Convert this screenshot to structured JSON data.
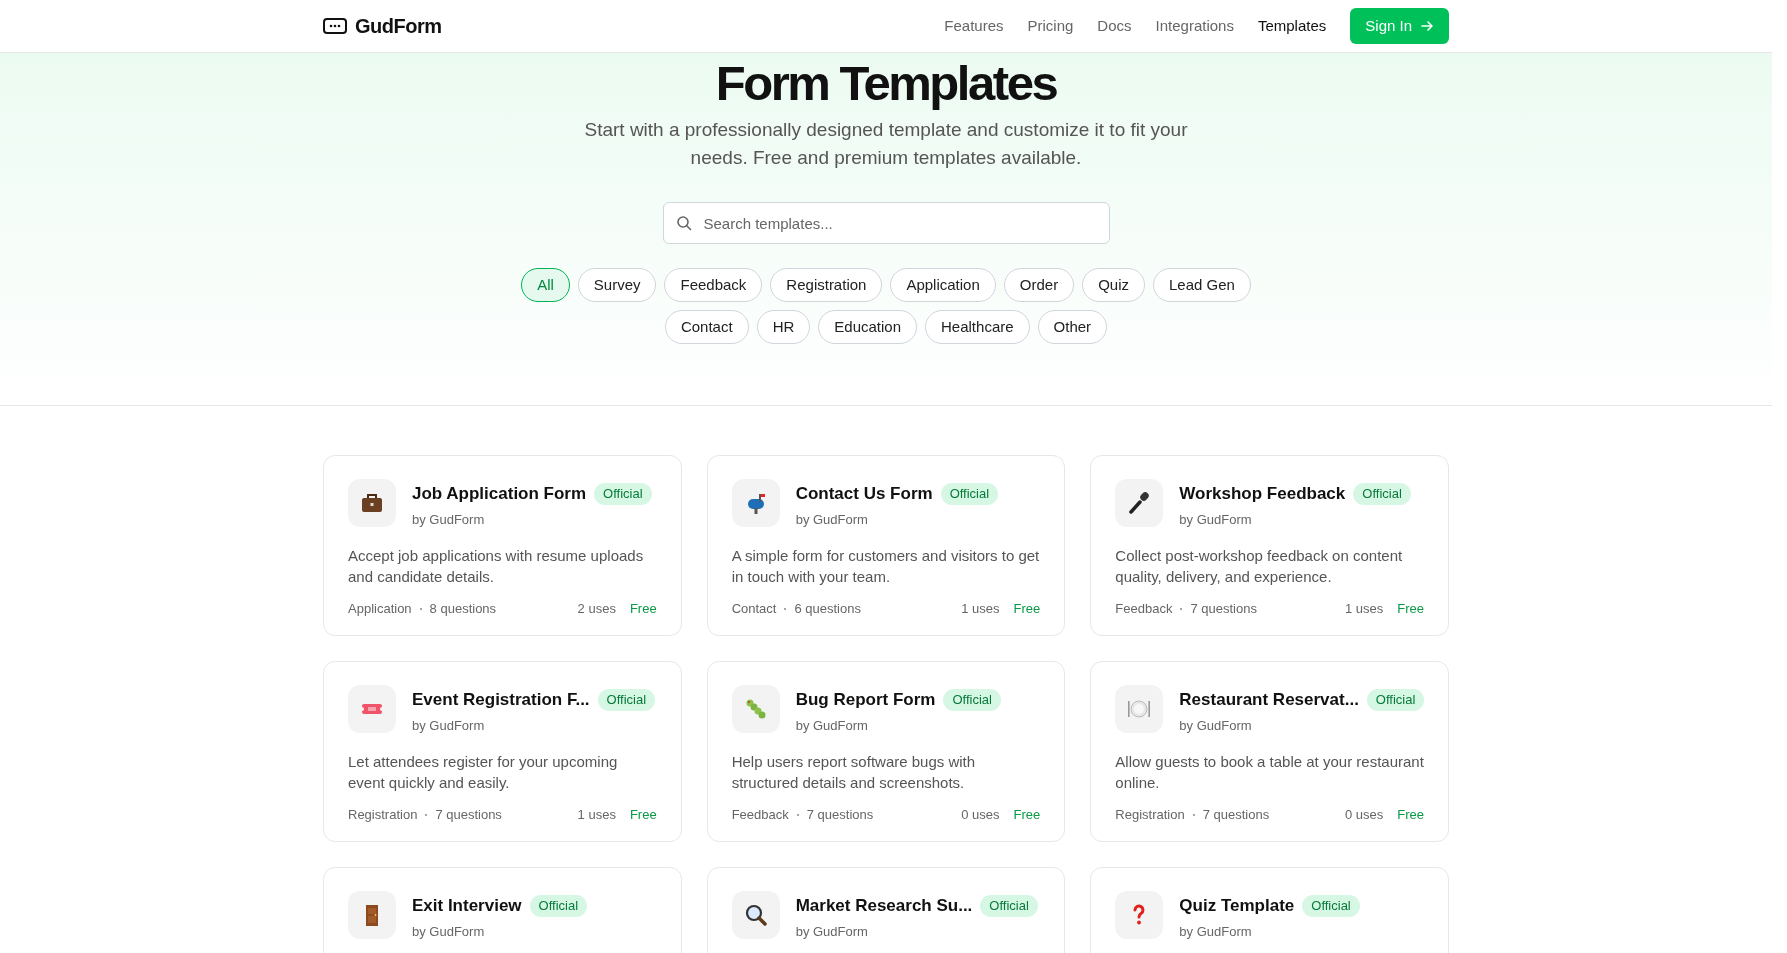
{
  "nav": {
    "brand": "GudForm",
    "links": [
      {
        "label": "Features",
        "selected": false
      },
      {
        "label": "Pricing",
        "selected": false
      },
      {
        "label": "Docs",
        "selected": false
      },
      {
        "label": "Integrations",
        "selected": false
      },
      {
        "label": "Templates",
        "selected": true
      }
    ],
    "cta": "Sign In"
  },
  "hero": {
    "title": "Form Templates",
    "subtitle": "Start with a professionally designed template and customize it to fit your needs. Free and premium templates available.",
    "search": {
      "placeholder": "Search templates..."
    }
  },
  "filters": [
    [
      {
        "label": "All",
        "selected": true
      },
      {
        "label": "Survey",
        "selected": false
      },
      {
        "label": "Feedback",
        "selected": false
      },
      {
        "label": "Registration",
        "selected": false
      },
      {
        "label": "Application",
        "selected": false
      },
      {
        "label": "Order",
        "selected": false
      },
      {
        "label": "Quiz",
        "selected": false
      },
      {
        "label": "Lead Gen",
        "selected": false
      }
    ],
    [
      {
        "label": "Contact",
        "selected": false
      },
      {
        "label": "HR",
        "selected": false
      },
      {
        "label": "Education",
        "selected": false
      },
      {
        "label": "Healthcare",
        "selected": false
      },
      {
        "label": "Other",
        "selected": false
      }
    ]
  ],
  "templates": [
    {
      "title": "Job Application Form",
      "badge": "Official",
      "author": "by GudForm",
      "description": "Accept job applications with resume uploads and candidate details.",
      "category": "Application",
      "questions": "8 questions",
      "uses": "2 uses",
      "price": "Free"
    },
    {
      "title": "Contact Us Form",
      "badge": "Official",
      "author": "by GudForm",
      "description": "A simple form for customers and visitors to get in touch with your team.",
      "category": "Contact",
      "questions": "6 questions",
      "uses": "1 uses",
      "price": "Free"
    },
    {
      "title": "Workshop Feedback",
      "badge": "Official",
      "author": "by GudForm",
      "description": "Collect post-workshop feedback on content quality, delivery, and experience.",
      "category": "Feedback",
      "questions": "7 questions",
      "uses": "1 uses",
      "price": "Free"
    },
    {
      "title": "Event Registration F...",
      "badge": "Official",
      "author": "by GudForm",
      "description": "Let attendees register for your upcoming event quickly and easily.",
      "category": "Registration",
      "questions": "7 questions",
      "uses": "1 uses",
      "price": "Free"
    },
    {
      "title": "Bug Report Form",
      "badge": "Official",
      "author": "by GudForm",
      "description": "Help users report software bugs with structured details and screenshots.",
      "category": "Feedback",
      "questions": "7 questions",
      "uses": "0 uses",
      "price": "Free"
    },
    {
      "title": "Restaurant Reservat...",
      "badge": "Official",
      "author": "by GudForm",
      "description": "Allow guests to book a table at your restaurant online.",
      "category": "Registration",
      "questions": "7 questions",
      "uses": "0 uses",
      "price": "Free"
    },
    {
      "title": "Exit Interview",
      "badge": "Official",
      "author": "by GudForm"
    },
    {
      "title": "Market Research Su...",
      "badge": "Official",
      "author": "by GudForm"
    },
    {
      "title": "Quiz Template",
      "badge": "Official",
      "author": "by GudForm"
    }
  ]
}
